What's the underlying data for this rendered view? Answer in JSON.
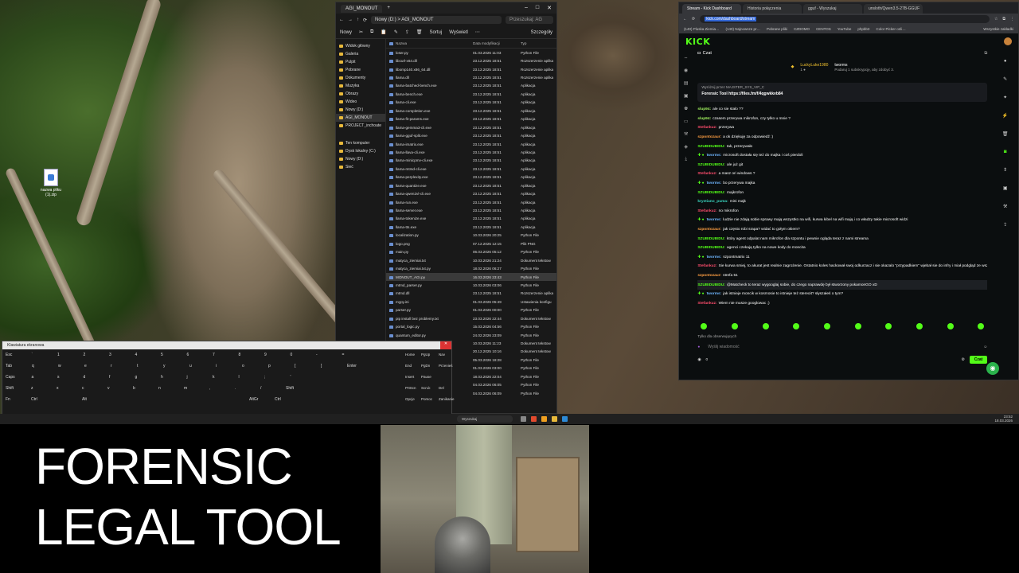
{
  "overlay": {
    "title_line1": "FORENSIC",
    "title_line2": "LEGAL TOOL"
  },
  "desktop": {
    "icon_label": "nazwa pliku (1).zip"
  },
  "explorer": {
    "tab_title": "AGI_MONOUT",
    "path": "Nowy (D:)  >  AGI_MONOUT",
    "search_placeholder": "Przeszukaj: AG",
    "toolbar": {
      "new": "Nowy",
      "sort": "Sortuj",
      "view": "Wyświetl",
      "details": "Szczegóły"
    },
    "nav": [
      "Widok główny",
      "Galeria",
      "Pulpit",
      "Pobrane",
      "Dokumenty",
      "Muzyka",
      "Obrazy",
      "Wideo",
      "Nowy (D:)",
      "AGI_MONOUT",
      "PROJECT_inchoate",
      "Ten komputer",
      "Dysk lokalny (C:)",
      "Nowy (D:)",
      "Sieć"
    ],
    "columns": {
      "name": "Nazwa",
      "date": "Data modyfikacji",
      "type": "Typ"
    },
    "files": [
      {
        "name": "loser.py",
        "date": "01.03.2026 11:03",
        "type": "Python File"
      },
      {
        "name": "libcurl-x64.dll",
        "date": "23.12.2025 18:51",
        "type": "Rozszerzenie aplika"
      },
      {
        "name": "libomp140.x86_64.dll",
        "date": "23.12.2025 18:51",
        "type": "Rozszerzenie aplika"
      },
      {
        "name": "llama.dll",
        "date": "23.12.2025 18:51",
        "type": "Rozszerzenie aplika"
      },
      {
        "name": "llama-batched-bench.exe",
        "date": "23.12.2025 18:51",
        "type": "Aplikacja"
      },
      {
        "name": "llama-bench.exe",
        "date": "23.12.2025 18:51",
        "type": "Aplikacja"
      },
      {
        "name": "llama-cli.exe",
        "date": "23.12.2025 18:51",
        "type": "Aplikacja"
      },
      {
        "name": "llama-completion.exe",
        "date": "23.12.2025 18:51",
        "type": "Aplikacja"
      },
      {
        "name": "llama-fit-params.exe",
        "date": "23.12.2025 18:51",
        "type": "Aplikacja"
      },
      {
        "name": "llama-gemma3-cli.exe",
        "date": "23.12.2025 18:51",
        "type": "Aplikacja"
      },
      {
        "name": "llama-gguf-split.exe",
        "date": "23.12.2025 18:51",
        "type": "Aplikacja"
      },
      {
        "name": "llama-imatrix.exe",
        "date": "23.12.2025 18:51",
        "type": "Aplikacja"
      },
      {
        "name": "llama-llava-cli.exe",
        "date": "23.12.2025 18:51",
        "type": "Aplikacja"
      },
      {
        "name": "llama-minicpmv-cli.exe",
        "date": "23.12.2025 18:51",
        "type": "Aplikacja"
      },
      {
        "name": "llama-mtmd-cli.exe",
        "date": "23.12.2025 18:51",
        "type": "Aplikacja"
      },
      {
        "name": "llama-perplexity.exe",
        "date": "23.12.2025 18:51",
        "type": "Aplikacja"
      },
      {
        "name": "llama-quantize.exe",
        "date": "23.12.2025 18:51",
        "type": "Aplikacja"
      },
      {
        "name": "llama-qwen2vl-cli.exe",
        "date": "23.12.2025 18:51",
        "type": "Aplikacja"
      },
      {
        "name": "llama-run.exe",
        "date": "23.12.2025 18:51",
        "type": "Aplikacja"
      },
      {
        "name": "llama-server.exe",
        "date": "23.12.2025 18:51",
        "type": "Aplikacja"
      },
      {
        "name": "llama-tokenize.exe",
        "date": "23.12.2025 18:51",
        "type": "Aplikacja"
      },
      {
        "name": "llama-tts.exe",
        "date": "23.12.2025 18:51",
        "type": "Aplikacja"
      },
      {
        "name": "localization.py",
        "date": "10.03.2026 20:25",
        "type": "Python File"
      },
      {
        "name": "logo.png",
        "date": "07.12.2025 12:15",
        "type": "Plik PNG"
      },
      {
        "name": "main.py",
        "date": "06.03.2026 05:12",
        "type": "Python File"
      },
      {
        "name": "matyca_ziemiai.txt",
        "date": "10.03.2026 21:24",
        "type": "Dokument tekstow"
      },
      {
        "name": "matyca_ziemiai.txt.py",
        "date": "18.02.2026 06:27",
        "type": "Python File"
      },
      {
        "name": "MONOUT_AGI.py",
        "date": "16.03.2026 23:43",
        "type": "Python File"
      },
      {
        "name": "mtmd_parser.py",
        "date": "10.03.2026 03:06",
        "type": "Python File"
      },
      {
        "name": "mtmd.dll",
        "date": "23.12.2025 18:51",
        "type": "Rozszerzenie aplika"
      },
      {
        "name": "mypy.ini",
        "date": "01.03.2026 05:49",
        "type": "Ustawienia konfigu"
      },
      {
        "name": "parser.py",
        "date": "01.03.2026 00:00",
        "type": "Python File"
      },
      {
        "name": "pip install bez problemy.txt",
        "date": "23.03.2026 22:44",
        "type": "Dokument tekstow"
      },
      {
        "name": "portal_logic.py",
        "date": "15.03.2026 04:56",
        "type": "Python File"
      },
      {
        "name": "quantum_editor.py",
        "date": "24.02.2026 23:09",
        "type": "Python File"
      },
      {
        "name": "README.txt",
        "date": "10.03.2026 11:23",
        "type": "Dokument tekstow"
      },
      {
        "name": "requirements.txt",
        "date": "20.12.2025 10:16",
        "type": "Dokument tekstow"
      },
      {
        "name": "rewizor.py",
        "date": "05.03.2026 18:28",
        "type": "Python File"
      },
      {
        "name": "sanitize.py",
        "date": "01.03.2026 03:00",
        "type": "Python File"
      },
      {
        "name": "test_exec.py",
        "date": "18.03.2026 22:04",
        "type": "Python File"
      },
      {
        "name": "tools.py",
        "date": "04.03.2026 06:05",
        "type": "Python File"
      },
      {
        "name": "ui_config.py",
        "date": "04.03.2026 06:09",
        "type": "Python File"
      }
    ]
  },
  "browser": {
    "tabs": [
      "Stream - Kick Dashboard",
      "Historia połączenia",
      "gguf - Wyszukaj",
      "unsloth/Qwen3.5-27B-GGUF"
    ],
    "url_highlight": "kick.com/dashboard/stream",
    "bookmarks": [
      "(140) Pluska Ziemia…",
      "(140) Najnowsze pr…",
      "Pobrane pliki",
      "CZDOMO",
      "CENTOS",
      "YouTube",
      "phpbb3",
      "Color Picker onli…",
      "Wszystkie zakładki"
    ],
    "logo": "KICK",
    "chat": {
      "header": "Czat",
      "gift_user": "LuckyLuke1980",
      "gift_user2": "tworms",
      "gift_sub": "Podaruj 1 subskrypcję, aby zdobyć 3.",
      "pinned_label": "Wyróżnij przez MAJSTER_SYS_VIP_C",
      "pinned_text": "Forensic Tool https://files.fm/f/4qgwkkvb84",
      "messages": [
        {
          "user": "slup94:",
          "cls": "u-lime",
          "text": "ale co sie stalo ??"
        },
        {
          "user": "slup94:",
          "cls": "u-lime",
          "text": "czasem przerywa mikrofon, czy tylko u mnie ?"
        },
        {
          "user": "Stefankuz:",
          "cls": "u-red",
          "text": "przerywa"
        },
        {
          "user": "szpontozaur:",
          "cls": "u-orange",
          "text": "a ok dziękuję za odpowiedź :)"
        },
        {
          "user": "SZUBIDUBIDU:",
          "cls": "u-green",
          "text": "tak, przerywało"
        },
        {
          "user": "tworms:",
          "cls": "u-blue",
          "text": "microsoft dostała się też do majka i coś pierdoli"
        },
        {
          "user": "SZUBIDUBIDU:",
          "cls": "u-green",
          "text": "ale już git"
        },
        {
          "user": "Stefankuz:",
          "cls": "u-red",
          "text": "a masz ori windows ?"
        },
        {
          "user": "tworms:",
          "cls": "u-blue",
          "text": "bo przerywa majka"
        },
        {
          "user": "SZUBIDUBIDU:",
          "cls": "u-green",
          "text": "majkrofon"
        },
        {
          "user": "krystiano_puma:",
          "cls": "u-teal",
          "text": "mini majk"
        },
        {
          "user": "Stefankuz:",
          "cls": "u-red",
          "text": "no mikrofon"
        },
        {
          "user": "tworms:",
          "cls": "u-blue",
          "text": "ludzie nie zdają sobie sprawy mają wszystko na wifi, kurwa kibel na wifi mają i co władzy takie microsoft widzi"
        },
        {
          "user": "szpontozaur:",
          "cls": "u-orange",
          "text": "jak często robi srapa? widać to gołym okiem?"
        },
        {
          "user": "SZUBIDUBIDU:",
          "cls": "u-green",
          "text": "który agent odpalat nam mikrofon dla szpontu i pewnie ogląda teraz z nami streama"
        },
        {
          "user": "SZUBIDUBIDU:",
          "cls": "u-green",
          "text": "agenci czekają tylko na nowe kody do moncita"
        },
        {
          "user": "tworms:",
          "cls": "u-blue",
          "text": "szpontmatrix 11"
        },
        {
          "user": "Stefankuz:",
          "cls": "u-red",
          "text": "Sie kurwa smiej, to akurat jest realnie zagrożenie. Ostatnio koles hackował swoj odkurzacz i sie okazalo \"przypadkiem\" wjebał sie do infry i miał podgląd ze wszystkich odkurzaczy przez kamerę"
        },
        {
          "user": "szpontozaur:",
          "cls": "u-orange",
          "text": "strefa 51"
        },
        {
          "user": "SZUBIDUBIDU:",
          "cls": "u-green",
          "text": "@Matcheck to teraz wygooglaj sobie, do czego naprawdę był stworzony pokamonGO xD"
        },
        {
          "user": "tworms:",
          "cls": "u-blue",
          "text": "jak istnieje moncik w kosmosie to istnieje też stereoit? słyszałeś o tym?"
        },
        {
          "user": "Stefankuz:",
          "cls": "u-red",
          "text": "Wiem nie musze googlowac ;)"
        }
      ],
      "followers_only": "Tylko dla obserwujących",
      "input_placeholder": "Wyślij wiadomość",
      "send": "Czat",
      "count": "0"
    }
  },
  "keyboard": {
    "title": "Klawiatura ekranowa",
    "keys": [
      {
        "k": "Esc"
      },
      {
        "k": "`"
      },
      {
        "k": "1"
      },
      {
        "k": "2"
      },
      {
        "k": "3"
      },
      {
        "k": "4"
      },
      {
        "k": "5"
      },
      {
        "k": "6"
      },
      {
        "k": "7"
      },
      {
        "k": "8"
      },
      {
        "k": "9"
      },
      {
        "k": "0"
      },
      {
        "k": "-"
      },
      {
        "k": "="
      },
      {
        "k": "Tab"
      },
      {
        "k": "q"
      },
      {
        "k": "w"
      },
      {
        "k": "e"
      },
      {
        "k": "r"
      },
      {
        "k": "t"
      },
      {
        "k": "y"
      },
      {
        "k": "u"
      },
      {
        "k": "i"
      },
      {
        "k": "o"
      },
      {
        "k": "p"
      },
      {
        "k": "["
      },
      {
        "k": "]"
      },
      {
        "k": "Enter"
      },
      {
        "k": "Caps"
      },
      {
        "k": "a"
      },
      {
        "k": "s"
      },
      {
        "k": "d"
      },
      {
        "k": "f"
      },
      {
        "k": "g"
      },
      {
        "k": "h"
      },
      {
        "k": "j"
      },
      {
        "k": "k"
      },
      {
        "k": "l"
      },
      {
        "k": ";"
      },
      {
        "k": "'"
      },
      {
        "k": "Shift"
      },
      {
        "k": "z"
      },
      {
        "k": "x"
      },
      {
        "k": "c"
      },
      {
        "k": "v"
      },
      {
        "k": "b"
      },
      {
        "k": "n"
      },
      {
        "k": "m"
      },
      {
        "k": ","
      },
      {
        "k": "."
      },
      {
        "k": "/"
      },
      {
        "k": "Shift"
      },
      {
        "k": "Fn"
      },
      {
        "k": "Ctrl"
      },
      {
        "k": "Alt"
      },
      {
        "k": "AltGr"
      },
      {
        "k": "Ctrl"
      },
      {
        "k": "Home"
      },
      {
        "k": "PgUp"
      },
      {
        "k": "Nav"
      },
      {
        "k": "End"
      },
      {
        "k": "PgDn"
      },
      {
        "k": "Przenieś"
      },
      {
        "k": "Insert"
      },
      {
        "k": "Pause"
      },
      {
        "k": "PrtScn"
      },
      {
        "k": "ScrLk"
      },
      {
        "k": "Del"
      },
      {
        "k": "Opcje"
      },
      {
        "k": "Pomoc"
      },
      {
        "k": "Zanikanie"
      }
    ]
  },
  "taskbar": {
    "search": "Wyszukaj",
    "time": "23:52",
    "date": "18.03.2026"
  }
}
